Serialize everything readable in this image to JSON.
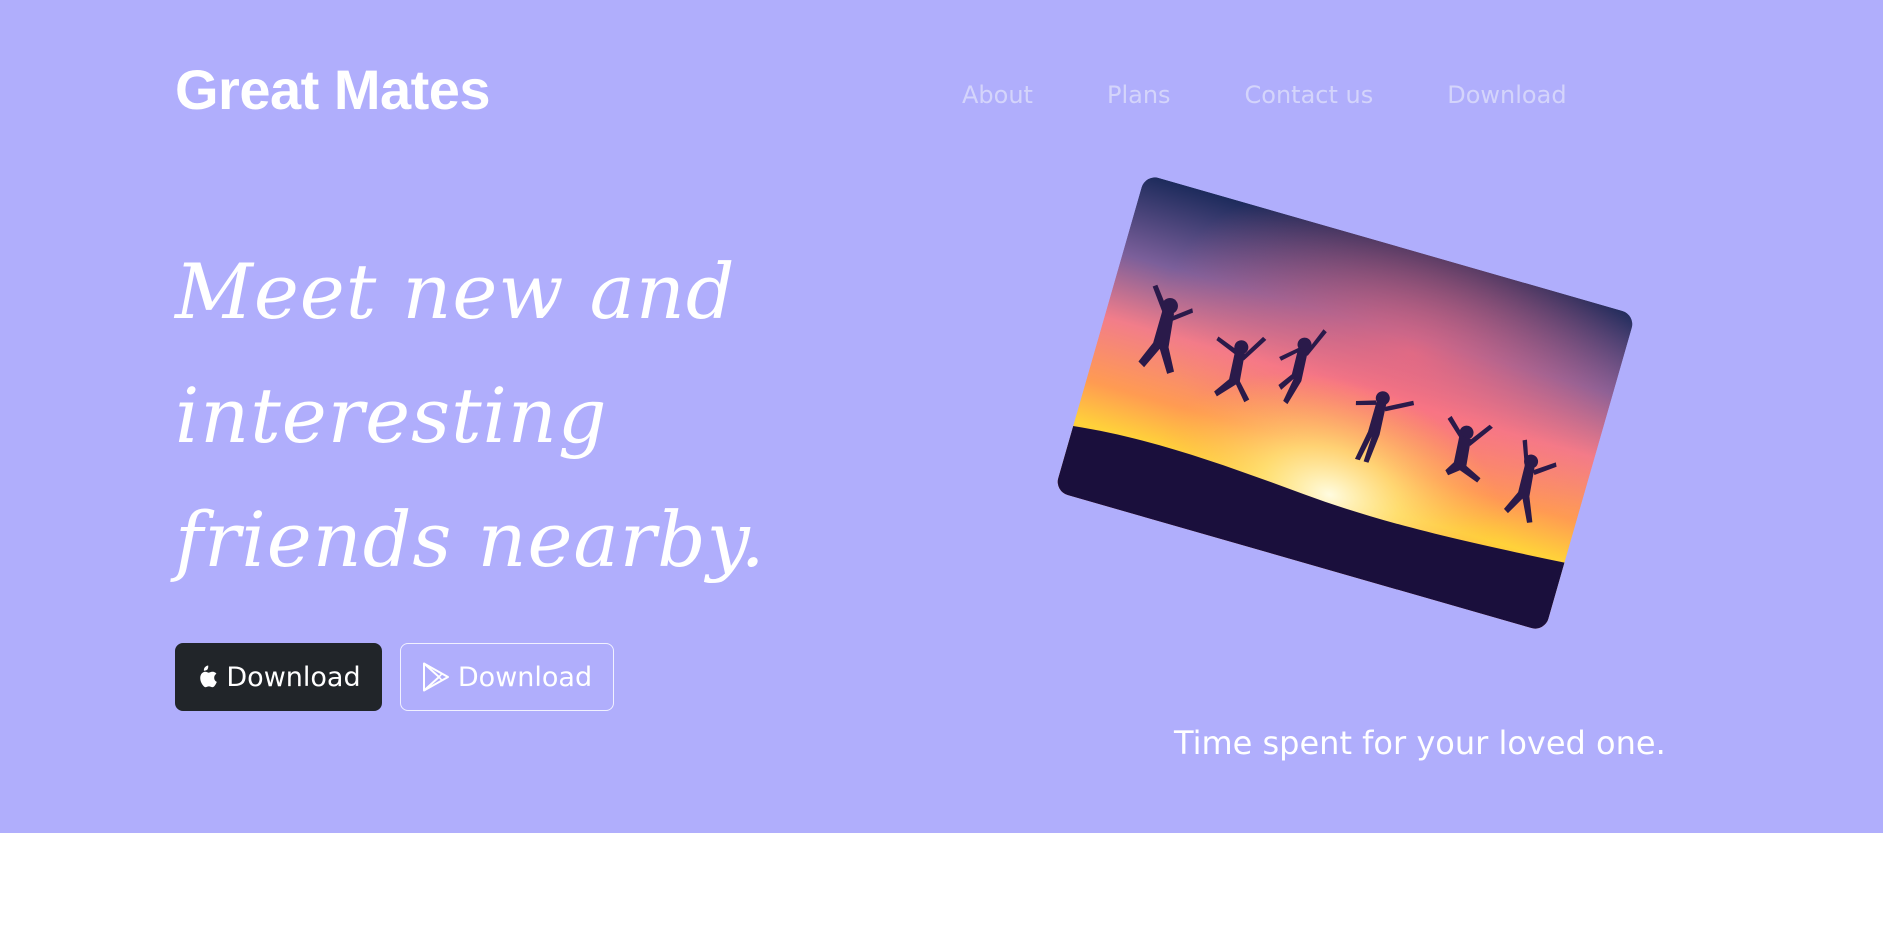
{
  "brand": {
    "name": "Great Mates"
  },
  "nav": {
    "items": [
      {
        "label": "About"
      },
      {
        "label": "Plans"
      },
      {
        "label": "Contact us"
      },
      {
        "label": "Download"
      }
    ]
  },
  "hero": {
    "headline": "Meet new and interesting friends nearby.",
    "buttons": {
      "apple_label": "Download",
      "google_label": "Download"
    },
    "image_alt_icon": "jumping-friends-sunset-photo",
    "tagline": "Time spent for your loved one."
  },
  "colors": {
    "hero_background": "#b0aefc",
    "nav_text": "#d4d4fb",
    "apple_button": "#212529",
    "page_background": "#ffffff"
  }
}
